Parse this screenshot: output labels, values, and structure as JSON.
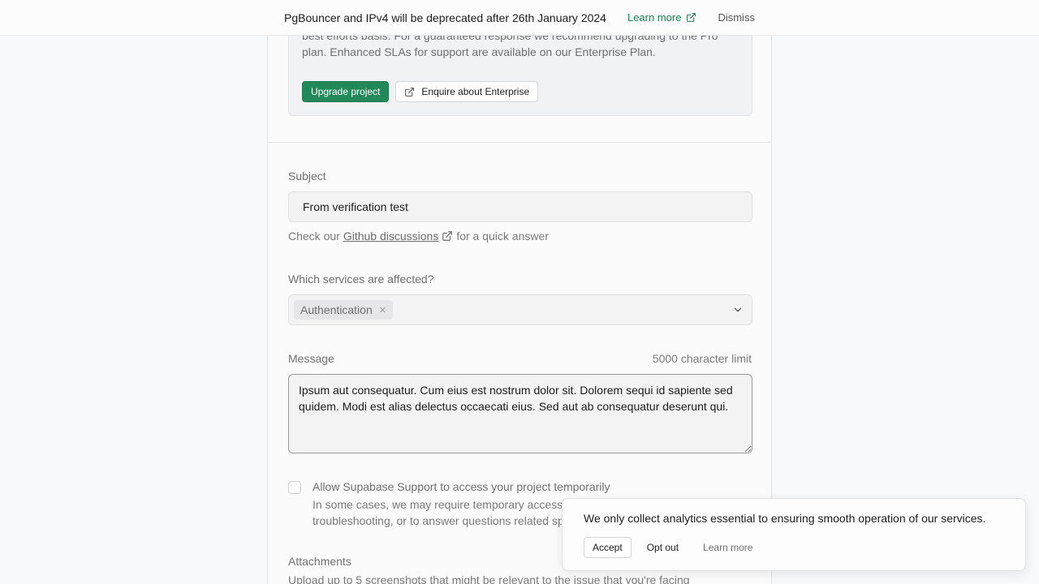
{
  "banner": {
    "text": "PgBouncer and IPv4 will be deprecated after 26th January 2024",
    "learn_more": "Learn more",
    "dismiss": "Dismiss"
  },
  "notice": {
    "text": "best efforts basis. For a guaranteed response we recommend upgrading to the Pro plan. Enhanced SLAs for support are available on our Enterprise Plan.",
    "upgrade_label": "Upgrade project",
    "enterprise_label": "Enquire about Enterprise"
  },
  "subject": {
    "label": "Subject",
    "value": "From verification test",
    "help_prefix": "Check our",
    "help_link": "Github discussions",
    "help_suffix": "for a quick answer"
  },
  "services": {
    "label": "Which services are affected?",
    "selected": [
      "Authentication"
    ]
  },
  "message": {
    "label": "Message",
    "limit": "5000 character limit",
    "value": "Ipsum aut consequatur. Cum eius est nostrum dolor sit. Dolorem sequi id sapiente sed quidem. Modi est alias delectus occaecati eius. Sed aut ab consequatur deserunt qui."
  },
  "consent": {
    "title": "Allow Supabase Support to access your project temporarily",
    "description": "In some cases, we may require temporary access to your project to complete troubleshooting, or to answer questions related specifically to your project",
    "checked": false
  },
  "attachments": {
    "label": "Attachments",
    "description": "Upload up to 5 screenshots that might be relevant to the issue that you're facing"
  },
  "cookie": {
    "text": "We only collect analytics essential to ensuring smooth operation of our services.",
    "accept": "Accept",
    "opt_out": "Opt out",
    "learn_more": "Learn more"
  },
  "colors": {
    "brand": "#23885a",
    "link": "#1f7a53"
  },
  "icons": {
    "external_link": "external-link-icon",
    "chevron": "chevron-down-icon",
    "remove": "close-icon"
  }
}
